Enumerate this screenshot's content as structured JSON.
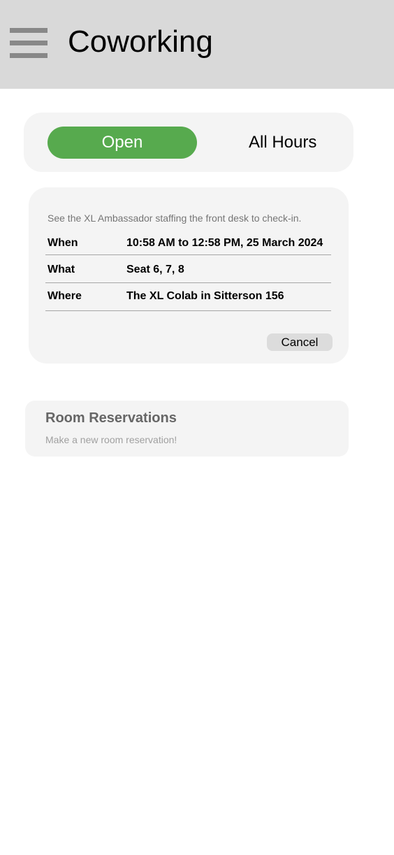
{
  "header": {
    "title": "Coworking",
    "menu_icon": "hamburger-menu-icon",
    "background": "#d9d9d9"
  },
  "status": {
    "state": "Open",
    "hours": "All Hours",
    "state_color": "#57aa4e"
  },
  "booking": {
    "instructions": "See the XL Ambassador staffing the front desk to check-in.",
    "rows": [
      {
        "label": "When",
        "value": "10:58 AM to 12:58 PM, 25 March 2024"
      },
      {
        "label": "What",
        "value": "Seat 6, 7, 8"
      },
      {
        "label": "Where",
        "value": "The XL Colab in Sitterson 156"
      }
    ],
    "cancel_label": "Cancel"
  },
  "reservations": {
    "title": "Room Reservations",
    "subtitle": "Make a new room reservation!"
  }
}
